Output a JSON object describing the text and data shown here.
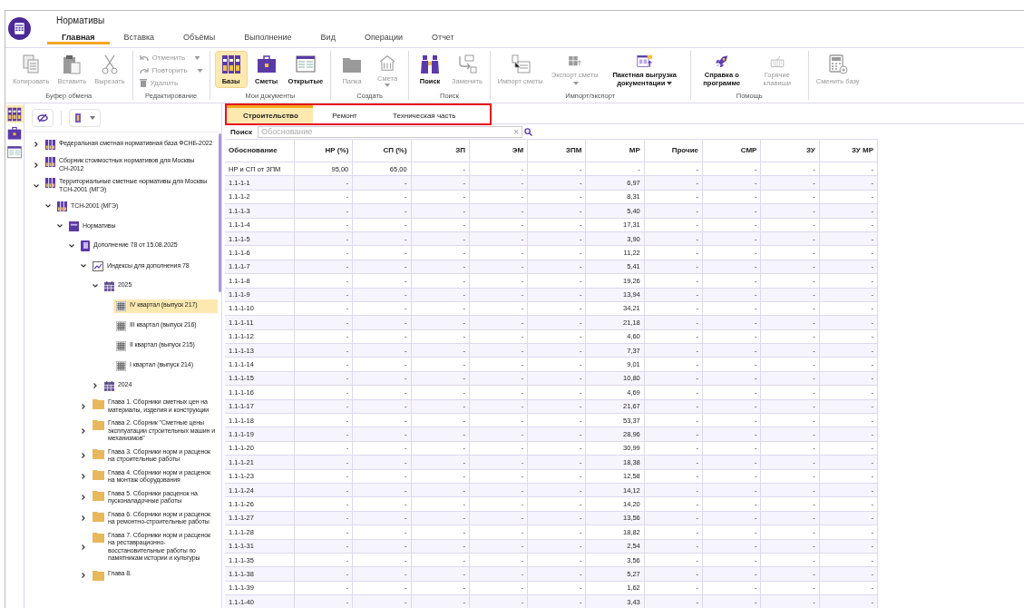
{
  "window": {
    "title": "Нормативы"
  },
  "menu_tabs": [
    {
      "label": "Главная",
      "selected": true
    },
    {
      "label": "Вставка",
      "selected": false
    },
    {
      "label": "Объёмы",
      "selected": false
    },
    {
      "label": "Выполнение",
      "selected": false
    },
    {
      "label": "Вид",
      "selected": false
    },
    {
      "label": "Операции",
      "selected": false
    },
    {
      "label": "Отчет",
      "selected": false
    }
  ],
  "ribbon": {
    "groups": [
      {
        "label": "Буфер обмена",
        "buttons": [
          {
            "kind": "large",
            "label": "Копировать",
            "disabled": true,
            "dropdown": false
          },
          {
            "kind": "large",
            "label": "Вставить",
            "disabled": true,
            "dropdown": false
          },
          {
            "kind": "large",
            "label": "Вырезать",
            "disabled": true,
            "dropdown": false
          }
        ]
      },
      {
        "label": "Редактирование",
        "buttons": [
          {
            "kind": "small",
            "label": "Отменить",
            "disabled": true,
            "dropdown": true
          },
          {
            "kind": "small",
            "label": "Повторить",
            "disabled": true,
            "dropdown": true
          },
          {
            "kind": "small",
            "label": "Удалить",
            "disabled": true,
            "dropdown": false
          }
        ]
      },
      {
        "label": "Мои документы",
        "buttons": [
          {
            "kind": "large",
            "label": "Базы",
            "disabled": false,
            "selected": true,
            "dropdown": false
          },
          {
            "kind": "large",
            "label": "Сметы",
            "disabled": false,
            "selected": false,
            "dropdown": false
          },
          {
            "kind": "large",
            "label": "Открытые",
            "disabled": false,
            "selected": false,
            "dropdown": false
          }
        ]
      },
      {
        "label": "Создать",
        "buttons": [
          {
            "kind": "large",
            "label": "Папка",
            "disabled": true,
            "dropdown": false
          },
          {
            "kind": "large",
            "label": "Смета",
            "disabled": true,
            "dropdown": true
          }
        ]
      },
      {
        "label": "Поиск",
        "buttons": [
          {
            "kind": "large",
            "label": "Поиск",
            "disabled": false,
            "dropdown": false
          },
          {
            "kind": "large",
            "label": "Заменить",
            "disabled": true,
            "dropdown": false
          }
        ]
      },
      {
        "label": "Импорт/экспорт",
        "buttons": [
          {
            "kind": "large",
            "label": "Импорт сметы",
            "disabled": true,
            "dropdown": false
          },
          {
            "kind": "large",
            "label": "Экспорт сметы",
            "disabled": true,
            "dropdown": true
          },
          {
            "kind": "large",
            "label": "Пакетная выгрузка документации",
            "disabled": false,
            "dropdown": true
          }
        ]
      },
      {
        "label": "Помощь",
        "buttons": [
          {
            "kind": "large",
            "label": "Справка о программе",
            "disabled": false,
            "dropdown": false
          },
          {
            "kind": "large",
            "label": "Горячие клавиши",
            "disabled": true,
            "dropdown": false
          }
        ]
      },
      {
        "buttons": [
          {
            "kind": "large",
            "label": "Сменить базу",
            "disabled": true,
            "dropdown": false
          }
        ]
      }
    ]
  },
  "side_strip": [
    {
      "selected": true
    },
    {
      "selected": false
    },
    {
      "selected": false
    }
  ],
  "tree": [
    {
      "kind": "base",
      "label": "Федеральная сметная нормативная база ФСНБ-2022",
      "expanded": false,
      "selected": false
    },
    {
      "kind": "base",
      "label": "Сборник стоимостных нормативов для Москвы СН-2012",
      "expanded": false,
      "selected": false
    },
    {
      "kind": "base",
      "label": "Территориальные сметные нормативы для Москвы ТСН-2001 (МГЭ)",
      "expanded": true,
      "selected": false,
      "children": [
        {
          "kind": "base",
          "label": "ТСН-2001 (МГЭ)",
          "expanded": true,
          "selected": false,
          "children": [
            {
              "kind": "norms",
              "label": "Нормативы",
              "expanded": true,
              "selected": false,
              "children": [
                {
                  "kind": "book",
                  "label": "Дополнение 78 от 15.08.2025",
                  "expanded": true,
                  "selected": false,
                  "children": [
                    {
                      "kind": "chart",
                      "label": "Индексы для дополнения 78",
                      "expanded": true,
                      "selected": false,
                      "children": [
                        {
                          "kind": "year",
                          "label": "2025",
                          "expanded": true,
                          "selected": false,
                          "children": [
                            {
                              "kind": "quarter",
                              "label": "IV квартал (выпуск 217)",
                              "selected": true
                            },
                            {
                              "kind": "quarter",
                              "label": "III квартал (выпуск 216)",
                              "selected": false
                            },
                            {
                              "kind": "quarter",
                              "label": "II квартал (выпуск 215)",
                              "selected": false
                            },
                            {
                              "kind": "quarter",
                              "label": "I квартал (выпуск 214)",
                              "selected": false
                            }
                          ]
                        },
                        {
                          "kind": "year",
                          "label": "2024",
                          "expanded": false,
                          "selected": false
                        }
                      ]
                    },
                    {
                      "kind": "folder",
                      "label": "Глава 1. Сборники сметных цен на материалы, изделия и конструкции",
                      "expanded": false,
                      "selected": false
                    },
                    {
                      "kind": "folder",
                      "label": "Глава 2. Сборник \"Сметные цены эксплуатации строительных машин и механизмов\"",
                      "expanded": false,
                      "selected": false
                    },
                    {
                      "kind": "folder",
                      "label": "Глава  3. Сборники норм и расценок на строительные работы",
                      "expanded": false,
                      "selected": false
                    },
                    {
                      "kind": "folder",
                      "label": "Глава  4. Сборники норм и расценок на монтаж оборудования",
                      "expanded": false,
                      "selected": false
                    },
                    {
                      "kind": "folder",
                      "label": "Глава  5. Сборники расценок на пусконаладочные работы",
                      "expanded": false,
                      "selected": false
                    },
                    {
                      "kind": "folder",
                      "label": "Глава  6. Сборники норм и расценок на ремонтно-строительные работы",
                      "expanded": false,
                      "selected": false
                    },
                    {
                      "kind": "folder",
                      "label": "Глава  7. Сборники норм и расценок на реставрационно-восстановительные работы по памятникам истории и культуры",
                      "expanded": false,
                      "selected": false
                    },
                    {
                      "kind": "folder",
                      "label": "Глава  8.",
                      "expanded": false,
                      "selected": false
                    }
                  ]
                }
              ]
            }
          ]
        }
      ]
    }
  ],
  "content_tabs": [
    {
      "label": "Строительство",
      "selected": true
    },
    {
      "label": "Ремонт",
      "selected": false
    },
    {
      "label": "Техническая часть",
      "selected": false
    }
  ],
  "search": {
    "label": "Поиск",
    "placeholder": "Обоснование",
    "clear": "×"
  },
  "table": {
    "columns": [
      "Обоснование",
      "НР (%)",
      "СП (%)",
      "ЗП",
      "ЭМ",
      "ЗПМ",
      "МР",
      "Прочие",
      "СМР",
      "ЗУ",
      "ЗУ МР"
    ],
    "rows": [
      [
        "НР и СП от ЗПМ",
        "95,00",
        "65,00",
        "-",
        "-",
        "-",
        "-",
        "-",
        "-",
        "-",
        "-"
      ],
      [
        "1.1-1-1",
        "-",
        "-",
        "-",
        "-",
        "-",
        "6,97",
        "-",
        "-",
        "-",
        "-"
      ],
      [
        "1.1-1-2",
        "-",
        "-",
        "-",
        "-",
        "-",
        "8,31",
        "-",
        "-",
        "-",
        "-"
      ],
      [
        "1.1-1-3",
        "-",
        "-",
        "-",
        "-",
        "-",
        "5,40",
        "-",
        "-",
        "-",
        "-"
      ],
      [
        "1.1-1-4",
        "-",
        "-",
        "-",
        "-",
        "-",
        "17,31",
        "-",
        "-",
        "-",
        "-"
      ],
      [
        "1.1-1-5",
        "-",
        "-",
        "-",
        "-",
        "-",
        "3,90",
        "-",
        "-",
        "-",
        "-"
      ],
      [
        "1.1-1-6",
        "-",
        "-",
        "-",
        "-",
        "-",
        "11,22",
        "-",
        "-",
        "-",
        "-"
      ],
      [
        "1.1-1-7",
        "-",
        "-",
        "-",
        "-",
        "-",
        "5,41",
        "-",
        "-",
        "-",
        "-"
      ],
      [
        "1.1-1-8",
        "-",
        "-",
        "-",
        "-",
        "-",
        "19,26",
        "-",
        "-",
        "-",
        "-"
      ],
      [
        "1.1-1-9",
        "-",
        "-",
        "-",
        "-",
        "-",
        "13,94",
        "-",
        "-",
        "-",
        "-"
      ],
      [
        "1.1-1-10",
        "-",
        "-",
        "-",
        "-",
        "-",
        "34,21",
        "-",
        "-",
        "-",
        "-"
      ],
      [
        "1.1-1-11",
        "-",
        "-",
        "-",
        "-",
        "-",
        "21,18",
        "-",
        "-",
        "-",
        "-"
      ],
      [
        "1.1-1-12",
        "-",
        "-",
        "-",
        "-",
        "-",
        "4,60",
        "-",
        "-",
        "-",
        "-"
      ],
      [
        "1.1-1-13",
        "-",
        "-",
        "-",
        "-",
        "-",
        "7,37",
        "-",
        "-",
        "-",
        "-"
      ],
      [
        "1.1-1-14",
        "-",
        "-",
        "-",
        "-",
        "-",
        "9,01",
        "-",
        "-",
        "-",
        "-"
      ],
      [
        "1.1-1-15",
        "-",
        "-",
        "-",
        "-",
        "-",
        "10,80",
        "-",
        "-",
        "-",
        "-"
      ],
      [
        "1.1-1-16",
        "-",
        "-",
        "-",
        "-",
        "-",
        "4,69",
        "-",
        "-",
        "-",
        "-"
      ],
      [
        "1.1-1-17",
        "-",
        "-",
        "-",
        "-",
        "-",
        "21,67",
        "-",
        "-",
        "-",
        "-"
      ],
      [
        "1.1-1-18",
        "-",
        "-",
        "-",
        "-",
        "-",
        "53,37",
        "-",
        "-",
        "-",
        "-"
      ],
      [
        "1.1-1-19",
        "-",
        "-",
        "-",
        "-",
        "-",
        "28,96",
        "-",
        "-",
        "-",
        "-"
      ],
      [
        "1.1-1-20",
        "-",
        "-",
        "-",
        "-",
        "-",
        "30,99",
        "-",
        "-",
        "-",
        "-"
      ],
      [
        "1.1-1-21",
        "-",
        "-",
        "-",
        "-",
        "-",
        "18,38",
        "-",
        "-",
        "-",
        "-"
      ],
      [
        "1.1-1-23",
        "-",
        "-",
        "-",
        "-",
        "-",
        "12,58",
        "-",
        "-",
        "-",
        "-"
      ],
      [
        "1.1-1-24",
        "-",
        "-",
        "-",
        "-",
        "-",
        "14,12",
        "-",
        "-",
        "-",
        "-"
      ],
      [
        "1.1-1-26",
        "-",
        "-",
        "-",
        "-",
        "-",
        "14,20",
        "-",
        "-",
        "-",
        "-"
      ],
      [
        "1.1-1-27",
        "-",
        "-",
        "-",
        "-",
        "-",
        "13,56",
        "-",
        "-",
        "-",
        "-"
      ],
      [
        "1.1-1-28",
        "-",
        "-",
        "-",
        "-",
        "-",
        "18,82",
        "-",
        "-",
        "-",
        "-"
      ],
      [
        "1.1-1-31",
        "-",
        "-",
        "-",
        "-",
        "-",
        "2,54",
        "-",
        "-",
        "-",
        "-"
      ],
      [
        "1.1-1-35",
        "-",
        "-",
        "-",
        "-",
        "-",
        "3,56",
        "-",
        "-",
        "-",
        "-"
      ],
      [
        "1.1-1-38",
        "-",
        "-",
        "-",
        "-",
        "-",
        "5,27",
        "-",
        "-",
        "-",
        "-"
      ],
      [
        "1.1-1-39",
        "-",
        "-",
        "-",
        "-",
        "-",
        "1,62",
        "-",
        "-",
        "-",
        "-"
      ],
      [
        "1.1-1-40",
        "-",
        "-",
        "-",
        "-",
        "-",
        "3,43",
        "-",
        "-",
        "-",
        "-"
      ]
    ]
  }
}
